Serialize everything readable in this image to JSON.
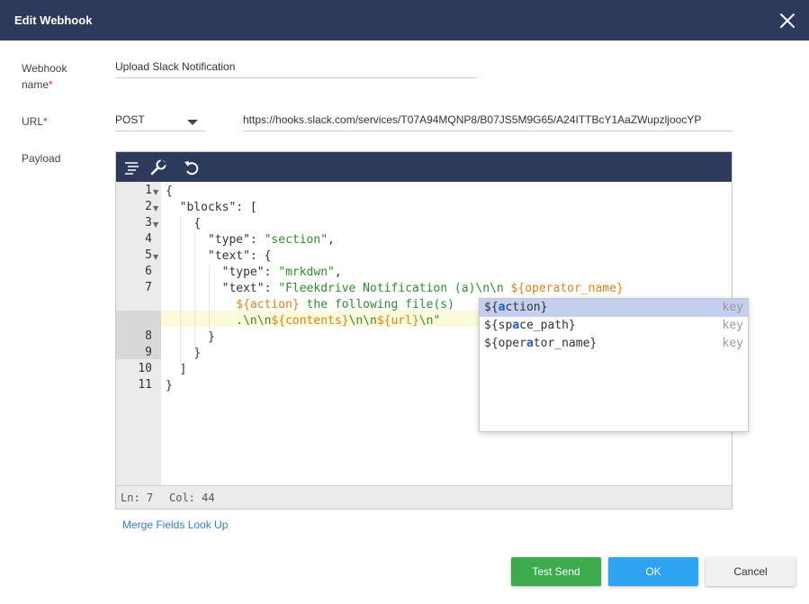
{
  "modal": {
    "title": "Edit Webhook"
  },
  "form": {
    "webhook_name_label": "Webhook name",
    "webhook_name_value": "Upload Slack Notification",
    "url_label": "URL",
    "method_value": "POST",
    "url_value": "https://hooks.slack.com/services/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",
    "payload_label": "Payload",
    "required_mark": "*"
  },
  "editor": {
    "toolbar": [
      "format-icon",
      "wrench-icon",
      "undo-icon"
    ],
    "line_numbers": [
      "1",
      "2",
      "3",
      "4",
      "5",
      "6",
      "7",
      "8",
      "9",
      "10",
      "11"
    ],
    "code": {
      "l1": "{",
      "l2_key": "\"blocks\"",
      "l2_rest": ": [",
      "l3": "{",
      "l4_key": "\"type\"",
      "l4_val": "\"section\"",
      "l5_key": "\"text\"",
      "l5_rest": ": {",
      "l6_key": "\"type\"",
      "l6_val": "\"mrkdwn\"",
      "l7_key": "\"text\"",
      "l7_str1": "\"Fleekdrive Notification (a",
      "l7_str2": ")\\n\\n ",
      "l7_var1": "${operator_name}",
      "l7b_var": "${action}",
      "l7b_str": " the following file(s)",
      "l7c_dot": ".\\n\\n",
      "l7c_var1": "${contents}",
      "l7c_str": "\\n\\n",
      "l7c_var2": "${url}",
      "l7c_end": "\\n\"",
      "l8": "}",
      "l9": "}",
      "l10": "]",
      "l11": "}"
    },
    "status": {
      "ln": "Ln: 7",
      "col": "Col: 44"
    }
  },
  "autocomplete": {
    "items": [
      {
        "pre": "${",
        "match": "a",
        "post": "ction}",
        "meta": "key"
      },
      {
        "pre": "${sp",
        "match": "a",
        "post": "ce_path}",
        "meta": "key"
      },
      {
        "pre": "${oper",
        "match": "a",
        "post": "tor_name}",
        "meta": "key"
      }
    ]
  },
  "links": {
    "merge_fields": "Merge Fields Look Up"
  },
  "buttons": {
    "test_send": "Test Send",
    "ok": "OK",
    "cancel": "Cancel"
  },
  "colors": {
    "header": "#2d3a5c",
    "test_send": "#3bab4e",
    "ok": "#2ea3f2",
    "string": "#2e8b2e",
    "variable": "#e28017"
  }
}
